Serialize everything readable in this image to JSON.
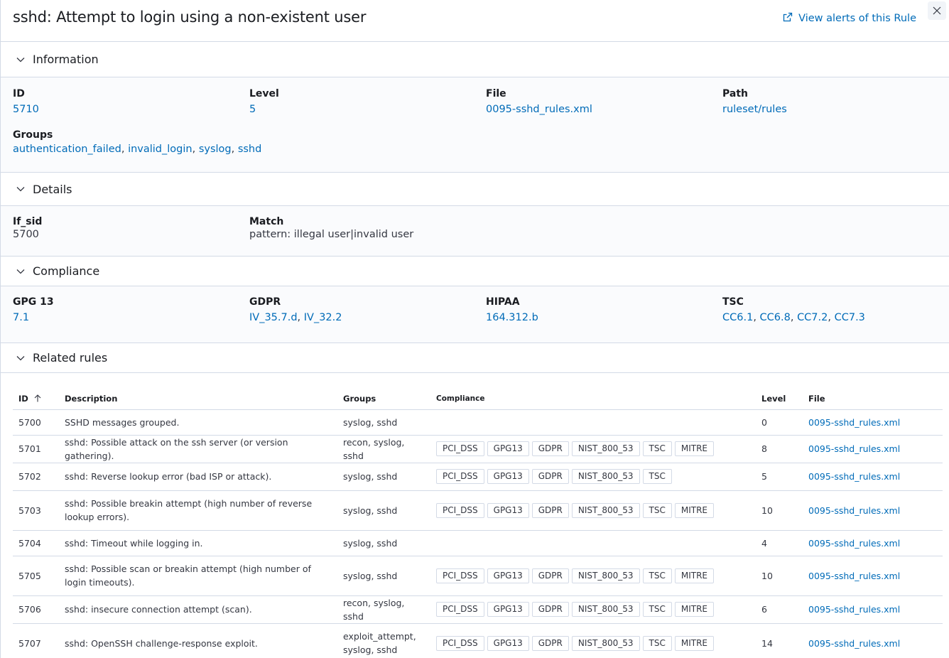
{
  "header": {
    "title": "sshd: Attempt to login using a non-existent user",
    "view_alerts_label": "View alerts of this Rule",
    "view_alerts_icon": "external-link-icon",
    "close_icon": "close-icon"
  },
  "sections": {
    "information": {
      "label": "Information",
      "id_label": "ID",
      "id_value": "5710",
      "level_label": "Level",
      "level_value": "5",
      "file_label": "File",
      "file_value": "0095-sshd_rules.xml",
      "path_label": "Path",
      "path_value": "ruleset/rules",
      "groups_label": "Groups",
      "groups": [
        "authentication_failed",
        "invalid_login",
        "syslog",
        "sshd"
      ]
    },
    "details": {
      "label": "Details",
      "if_sid_label": "If_sid",
      "if_sid_value": "5700",
      "match_label": "Match",
      "match_value": "pattern: illegal user|invalid user"
    },
    "compliance": {
      "label": "Compliance",
      "gpg13_label": "GPG 13",
      "gpg13": [
        "7.1"
      ],
      "gdpr_label": "GDPR",
      "gdpr": [
        "IV_35.7.d",
        "IV_32.2"
      ],
      "hipaa_label": "HIPAA",
      "hipaa": [
        "164.312.b"
      ],
      "tsc_label": "TSC",
      "tsc": [
        "CC6.1",
        "CC6.8",
        "CC7.2",
        "CC7.3"
      ]
    },
    "related": {
      "label": "Related rules"
    }
  },
  "table": {
    "columns": {
      "id": "ID",
      "description": "Description",
      "groups": "Groups",
      "compliance": "Compliance",
      "level": "Level",
      "file": "File"
    },
    "sort": {
      "column": "id",
      "direction": "ascending",
      "icon": "sort-ascending-icon"
    },
    "rows": [
      {
        "id": "5700",
        "description": "SSHD messages grouped.",
        "groups": "syslog, sshd",
        "compliance": [],
        "level": "0",
        "file": "0095-sshd_rules.xml"
      },
      {
        "id": "5701",
        "description": "sshd: Possible attack on the ssh server (or version gathering).",
        "groups": "recon, syslog, sshd",
        "compliance": [
          "PCI_DSS",
          "GPG13",
          "GDPR",
          "NIST_800_53",
          "TSC",
          "MITRE"
        ],
        "level": "8",
        "file": "0095-sshd_rules.xml"
      },
      {
        "id": "5702",
        "description": "sshd: Reverse lookup error (bad ISP or attack).",
        "groups": "syslog, sshd",
        "compliance": [
          "PCI_DSS",
          "GPG13",
          "GDPR",
          "NIST_800_53",
          "TSC"
        ],
        "level": "5",
        "file": "0095-sshd_rules.xml"
      },
      {
        "id": "5703",
        "description": "sshd: Possible breakin attempt (high number of reverse lookup errors).",
        "groups": "syslog, sshd",
        "compliance": [
          "PCI_DSS",
          "GPG13",
          "GDPR",
          "NIST_800_53",
          "TSC",
          "MITRE"
        ],
        "level": "10",
        "file": "0095-sshd_rules.xml"
      },
      {
        "id": "5704",
        "description": "sshd: Timeout while logging in.",
        "groups": "syslog, sshd",
        "compliance": [],
        "level": "4",
        "file": "0095-sshd_rules.xml"
      },
      {
        "id": "5705",
        "description": "sshd: Possible scan or breakin attempt (high number of login timeouts).",
        "groups": "syslog, sshd",
        "compliance": [
          "PCI_DSS",
          "GPG13",
          "GDPR",
          "NIST_800_53",
          "TSC",
          "MITRE"
        ],
        "level": "10",
        "file": "0095-sshd_rules.xml"
      },
      {
        "id": "5706",
        "description": "sshd: insecure connection attempt (scan).",
        "groups": "recon, syslog, sshd",
        "compliance": [
          "PCI_DSS",
          "GPG13",
          "GDPR",
          "NIST_800_53",
          "TSC",
          "MITRE"
        ],
        "level": "6",
        "file": "0095-sshd_rules.xml"
      },
      {
        "id": "5707",
        "description": "sshd: OpenSSH challenge-response exploit.",
        "groups": "exploit_attempt, syslog, sshd",
        "compliance": [
          "PCI_DSS",
          "GPG13",
          "GDPR",
          "NIST_800_53",
          "TSC",
          "MITRE"
        ],
        "level": "14",
        "file": "0095-sshd_rules.xml"
      }
    ]
  },
  "colors": {
    "link": "#006bb8",
    "border": "#d3dae6",
    "section_bg": "#fafbfd",
    "text": "#343741"
  }
}
